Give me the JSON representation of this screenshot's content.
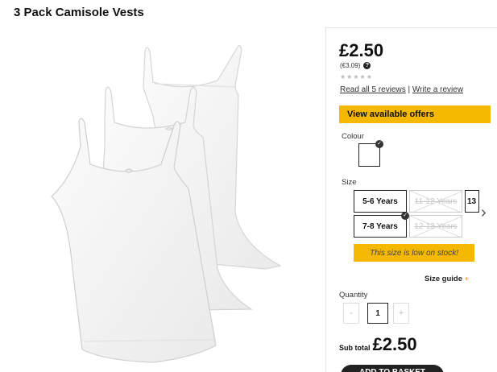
{
  "product": {
    "title": "3 Pack Camisole Vests",
    "price": "£2.50",
    "alt_price": "(€3.09)",
    "stars": "★★★★★",
    "reviews_link": "Read all 5 reviews",
    "review_separator": "|",
    "write_review_link": "Write a review"
  },
  "offers_button": "View available offers",
  "colour": {
    "label": "Colour",
    "selected": "white"
  },
  "size": {
    "label": "Size",
    "options": [
      {
        "label": "5-6 Years",
        "available": true
      },
      {
        "label": "11-12 Years",
        "available": false
      },
      {
        "label": "13",
        "available": true
      },
      {
        "label": "7-8 Years",
        "available": true,
        "selected": true
      },
      {
        "label": "12-13 Years",
        "available": false
      }
    ],
    "low_stock_message": "This size is low on stock!",
    "guide_link": "Size guide",
    "guide_plus": "+"
  },
  "quantity": {
    "label": "Quantity",
    "value": "1",
    "minus": "-",
    "plus": "+"
  },
  "subtotal": {
    "label": "Sub total",
    "value": "£2.50"
  },
  "add_button": "ADD TO BASKET",
  "colors": {
    "accent": "#f5b800",
    "text": "#111111",
    "button_dark": "#222222"
  }
}
